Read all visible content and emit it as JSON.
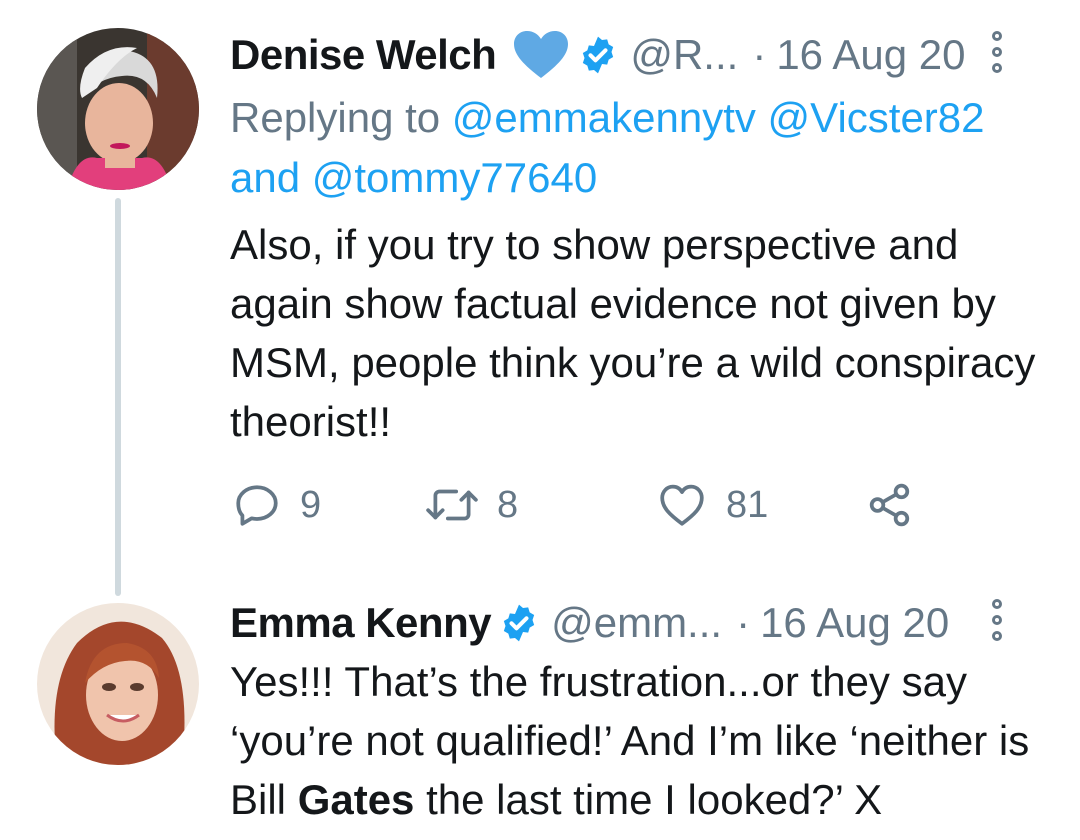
{
  "colors": {
    "accent": "#1da1f2",
    "text": "#14171a",
    "muted": "#657786",
    "heart": "#5fa9e4"
  },
  "tweets": [
    {
      "name": "Denise Welch",
      "handle": "@R...",
      "separator": "·",
      "date": "16 Aug 20",
      "reply_prefix": "Replying to",
      "reply_mentions": [
        "@emmakennytv",
        "@Vicster82"
      ],
      "reply_and": "and",
      "reply_last": "@tommy77640",
      "text": "Also, if you try to show perspective and again show factual evidence not given by MSM, people think you’re a wild conspiracy theorist!!",
      "icons": [
        "blue-heart-icon",
        "verified-badge-icon",
        "more-options-icon"
      ],
      "actions": {
        "replies": "9",
        "retweets": "8",
        "likes": "81"
      }
    },
    {
      "name": "Emma Kenny",
      "handle": "@emm...",
      "separator": "·",
      "date": "16 Aug 20",
      "text_before": "Yes!!! That’s the frustration...or they say ‘you’re not qualified!’ And I’m like ‘neither is Bill ",
      "text_bold": "Gates",
      "text_after": " the last time I looked?’ X",
      "icons": [
        "verified-badge-icon",
        "more-options-icon"
      ]
    }
  ]
}
